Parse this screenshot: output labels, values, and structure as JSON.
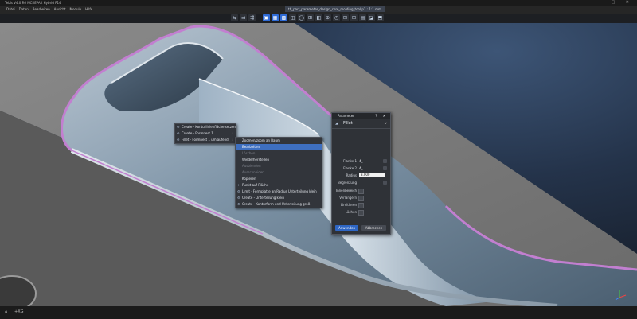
{
  "app": {
    "title": "Tebis V4.0 R6 MCREPAX Hybrid P14",
    "window_controls": "– □ ✕"
  },
  "menubar": {
    "items": [
      "Datei",
      "Daten",
      "Bearbeiten",
      "Ansicht",
      "Module",
      "Hilfe"
    ],
    "document_title": "tb_part_parameter_design_core_molding_tool.p1 : 1:1 mm"
  },
  "toolbar": {
    "group1": [
      "⇆",
      "⇉",
      "⇶"
    ],
    "group2": [
      "▣",
      "▦",
      "▩",
      "◫",
      "◯",
      "⊞",
      "◧",
      "⊕",
      "◷",
      "⊡",
      "⊟",
      "▤",
      "◪",
      "⬒"
    ]
  },
  "context_menu_left": {
    "items": [
      {
        "label": "Create - Konturlinienfläche setzen",
        "icon": "⚙"
      },
      {
        "label": "Create - Formnest 1",
        "icon": "⚙"
      },
      {
        "label": "Fillet - Formnest 1 umlaufend",
        "icon": "⚙"
      }
    ]
  },
  "context_menu_right": {
    "items": [
      {
        "label": "Zoomen/zoom an Baum",
        "state": "normal"
      },
      {
        "label": "Bearbeiten",
        "state": "selected"
      },
      {
        "label": "Löschen",
        "state": "disabled"
      },
      {
        "label": "Wiederherstellen",
        "state": "normal"
      },
      {
        "label": "Ausblenden",
        "state": "disabled"
      },
      {
        "label": "Ausschneiden",
        "state": "disabled"
      },
      {
        "label": "Kopieren",
        "state": "normal"
      },
      {
        "label": "Punkt auf Fläche",
        "state": "normal"
      },
      {
        "label": "Limit - Formplatte an Radius Unterteilung klein",
        "state": "normal"
      },
      {
        "label": "Create - Unterteilung klein",
        "state": "normal"
      },
      {
        "label": "Create - Konturform und Unterteilung groß",
        "state": "normal"
      }
    ]
  },
  "parameter_panel": {
    "title": "Parameter",
    "header_icons": "? ✕",
    "section": "Fillet",
    "flanke1_label": "Flanke 1",
    "flanke1_value": "4_",
    "flanke2_label": "Flanke 2",
    "flanke2_value": "4_",
    "radius_label": "Radius",
    "radius_value": "3.000",
    "begrenzung_label": "Begrenzung",
    "innen_label": "Innenbereich",
    "verlaengern_label": "Verlängern",
    "limitieren_label": "Limitieren",
    "loeschen_label": "Löchen",
    "apply_label": "Anwenden",
    "cancel_label": "Abbrechen"
  },
  "statusbar": {
    "home_icon": "⌂",
    "coord": "+XG"
  },
  "colors": {
    "accent": "#2f6bd6",
    "selection": "#3e6fc0",
    "edge_highlight": "#c27fd0"
  }
}
